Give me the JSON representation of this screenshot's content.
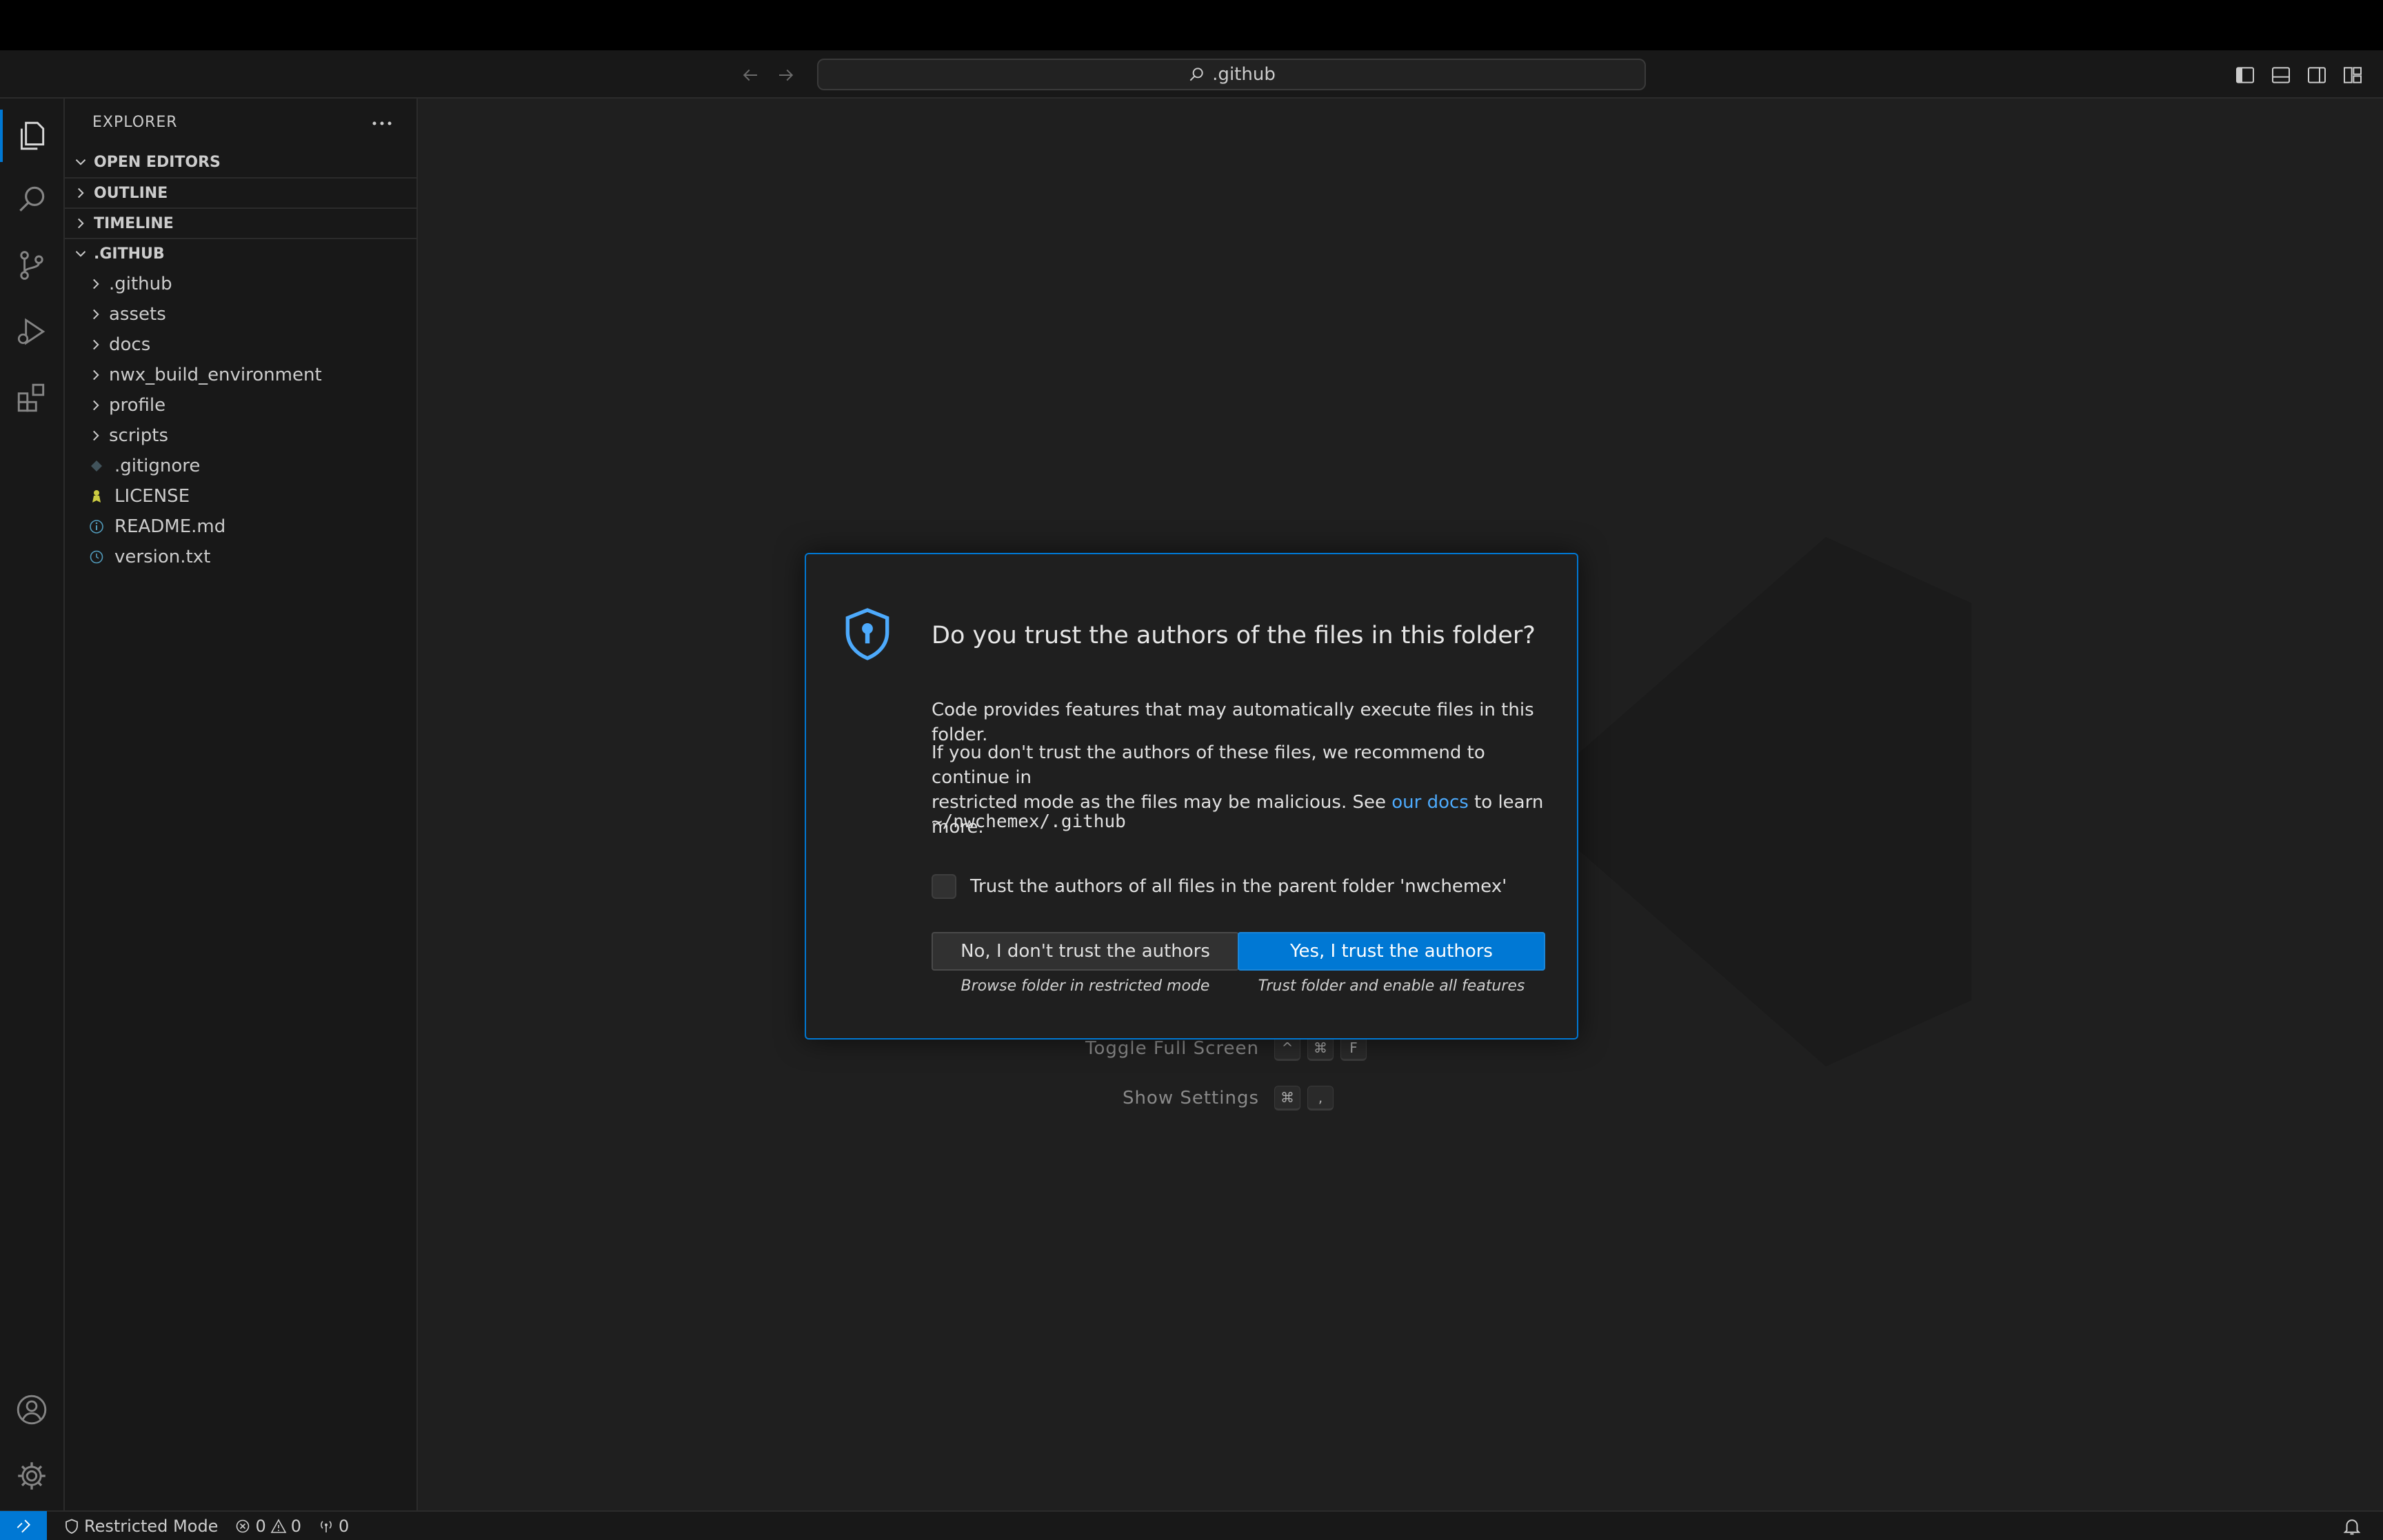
{
  "titlebar": {
    "search_text": ".github"
  },
  "sidebar": {
    "title": "EXPLORER",
    "sections": {
      "open_editors": "OPEN EDITORS",
      "outline": "OUTLINE",
      "timeline": "TIMELINE",
      "workspace": ".GITHUB"
    },
    "folders": [
      ".github",
      "assets",
      "docs",
      "nwx_build_environment",
      "profile",
      "scripts"
    ],
    "files": [
      {
        "name": ".gitignore",
        "icon": "gitignore-icon"
      },
      {
        "name": "LICENSE",
        "icon": "license-icon"
      },
      {
        "name": "README.md",
        "icon": "info-icon"
      },
      {
        "name": "version.txt",
        "icon": "clock-icon"
      }
    ]
  },
  "editor": {
    "shortcuts": [
      {
        "label": "Toggle Full Screen",
        "keys": [
          "^",
          "⌘",
          "F"
        ]
      },
      {
        "label": "Show Settings",
        "keys": [
          "⌘",
          ","
        ]
      }
    ]
  },
  "dialog": {
    "title": "Do you trust the authors of the files in this folder?",
    "line1": "Code provides features that may automatically execute files in this folder.",
    "line2a": "If you don't trust the authors of these files, we recommend to continue in",
    "line2b_pre": "restricted mode as the files may be malicious. See ",
    "link": "our docs",
    "line2b_post": " to learn more.",
    "path": "~/nwchemex/.github",
    "checkbox_label": "Trust the authors of all files in the parent folder 'nwchemex'",
    "no_button": "No, I don't trust the authors",
    "no_caption": "Browse folder in restricted mode",
    "yes_button": "Yes, I trust the authors",
    "yes_caption": "Trust folder and enable all features"
  },
  "statusbar": {
    "mode": "Restricted Mode",
    "errors": "0",
    "warnings": "0",
    "ports": "0"
  },
  "colors": {
    "accent": "#0078d4",
    "link": "#4daafc"
  }
}
